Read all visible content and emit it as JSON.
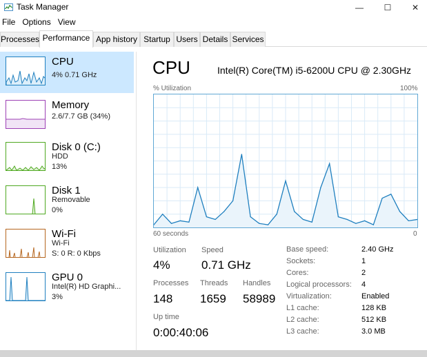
{
  "window": {
    "title": "Task Manager",
    "min_glyph": "—",
    "max_glyph": "☐",
    "close_glyph": "✕"
  },
  "menu": [
    "File",
    "Options",
    "View"
  ],
  "tabs": [
    "Processes",
    "Performance",
    "App history",
    "Startup",
    "Users",
    "Details",
    "Services"
  ],
  "active_tab": "Performance",
  "sidebar": {
    "items": [
      {
        "name": "CPU",
        "sub1": "4% 0.71 GHz",
        "sub2": "",
        "sub3": "",
        "color": "#1e7fbf"
      },
      {
        "name": "Memory",
        "sub1": "2.6/7.7 GB (34%)",
        "sub2": "",
        "sub3": "",
        "color": "#9c3fb4"
      },
      {
        "name": "Disk 0 (C:)",
        "sub1": "HDD",
        "sub2": "13%",
        "sub3": "",
        "color": "#4ea81f"
      },
      {
        "name": "Disk 1",
        "sub1": "Removable",
        "sub2": "0%",
        "sub3": "",
        "color": "#4ea81f"
      },
      {
        "name": "Wi-Fi",
        "sub1": "Wi-Fi",
        "sub2": "S: 0 R: 0 Kbps",
        "sub3": "",
        "color": "#b5651d"
      },
      {
        "name": "GPU 0",
        "sub1": "Intel(R) HD Graphi...",
        "sub2": "3%",
        "sub3": "",
        "color": "#1e7fbf"
      }
    ]
  },
  "main": {
    "title": "CPU",
    "model": "Intel(R) Core(TM) i5-6200U CPU @ 2.30GHz",
    "graph": {
      "top_left": "% Utilization",
      "top_right": "100%",
      "bottom_left": "60 seconds",
      "bottom_right": "0"
    },
    "stats": {
      "utilization_label": "Utilization",
      "utilization": "4%",
      "speed_label": "Speed",
      "speed": "0.71 GHz",
      "processes_label": "Processes",
      "processes": "148",
      "threads_label": "Threads",
      "threads": "1659",
      "handles_label": "Handles",
      "handles": "58989",
      "uptime_label": "Up time",
      "uptime": "0:00:40:06"
    },
    "specs": [
      {
        "label": "Base speed:",
        "value": "2.40 GHz"
      },
      {
        "label": "Sockets:",
        "value": "1"
      },
      {
        "label": "Cores:",
        "value": "2"
      },
      {
        "label": "Logical processors:",
        "value": "4"
      },
      {
        "label": "Virtualization:",
        "value": "Enabled"
      },
      {
        "label": "L1 cache:",
        "value": "128 KB"
      },
      {
        "label": "L2 cache:",
        "value": "512 KB"
      },
      {
        "label": "L3 cache:",
        "value": "3.0 MB"
      }
    ]
  },
  "chart_data": {
    "type": "area",
    "x": [
      60,
      58,
      56,
      54,
      52,
      50,
      48,
      46,
      44,
      42,
      40,
      38,
      36,
      34,
      32,
      30,
      28,
      26,
      24,
      22,
      20,
      18,
      16,
      14,
      12,
      10,
      8,
      6,
      4,
      2,
      0
    ],
    "values": [
      2,
      10,
      3,
      5,
      4,
      30,
      8,
      6,
      12,
      20,
      55,
      8,
      3,
      2,
      10,
      35,
      12,
      6,
      4,
      30,
      48,
      8,
      6,
      3,
      5,
      2,
      22,
      25,
      12,
      5,
      6
    ],
    "xlim": [
      60,
      0
    ],
    "ylim": [
      0,
      100
    ],
    "grid": true,
    "color": "#1e7fbf"
  }
}
